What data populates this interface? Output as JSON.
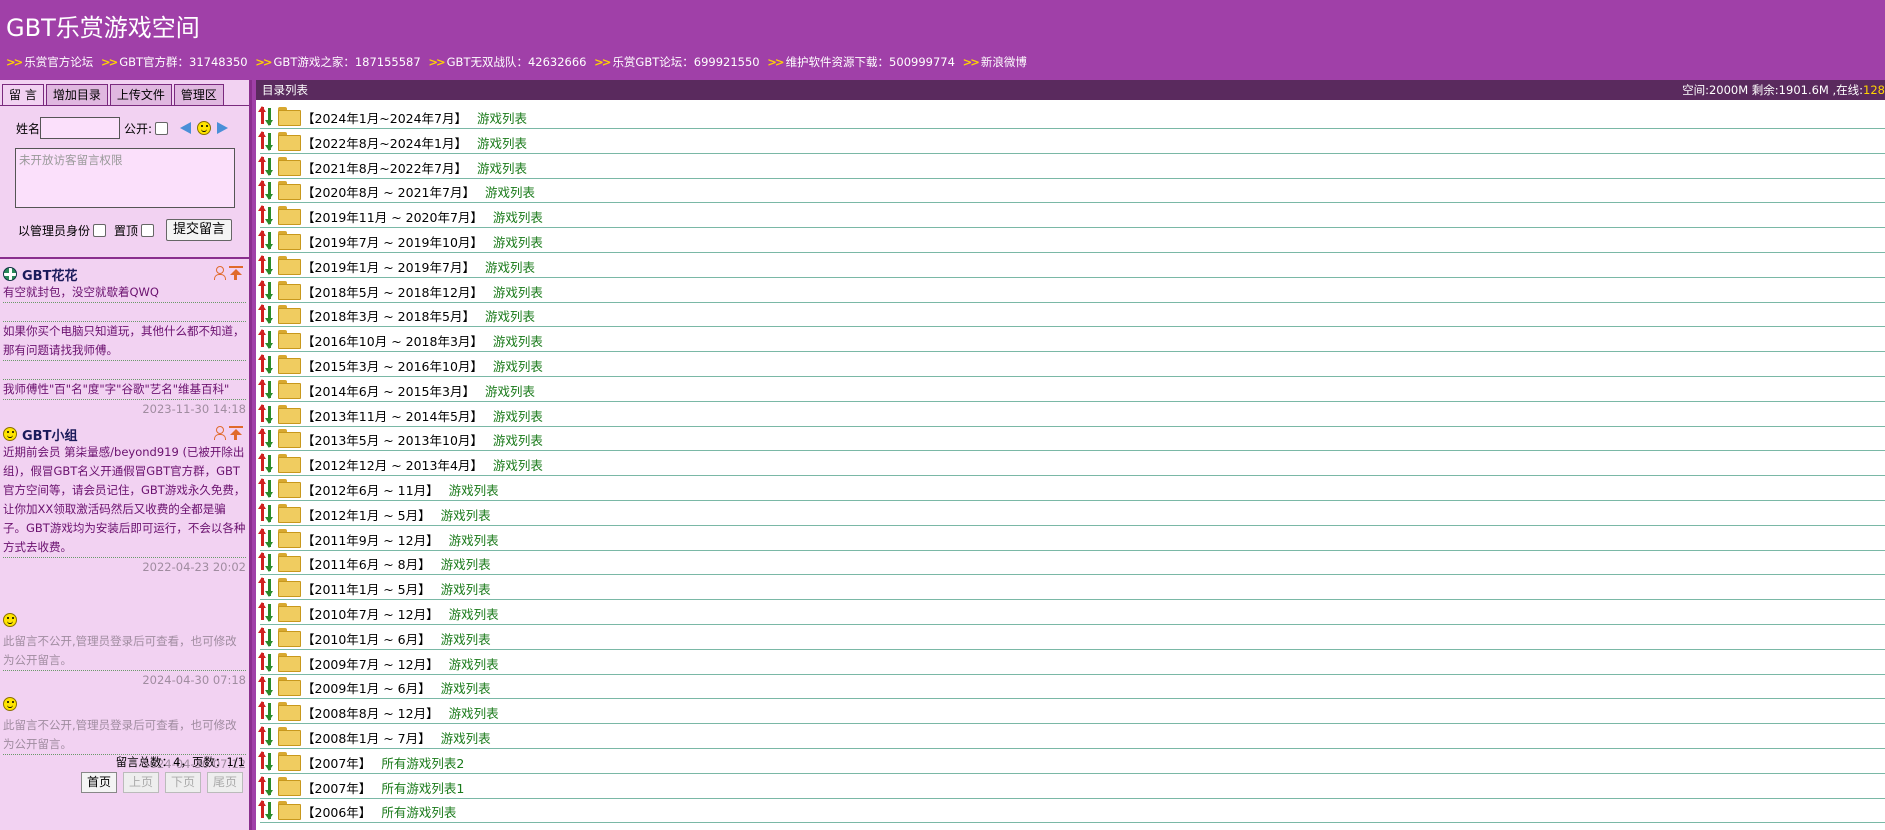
{
  "site_title": "GBT乐赏游戏空间",
  "links": [
    "乐赏官方论坛",
    "GBT官方群：31748350",
    "GBT游戏之家：187155587",
    "GBT无双战队：42632666",
    "乐赏GBT论坛：699921550",
    "维护软件资源下载：500999774",
    "新浪微博"
  ],
  "links_arrow": ">>",
  "tabs": [
    "留 言",
    "增加目录",
    "上传文件",
    "管理区"
  ],
  "form": {
    "name_label": "姓名",
    "public_label": "公开:",
    "textarea_placeholder": "未开放访客留言权限",
    "admin_label": "以管理员身份",
    "pin_label": "置顶",
    "submit_label": "提交留言"
  },
  "messages": [
    {
      "name": "GBT花花",
      "lines": [
        "有空就封包，没空就歇着QWQ",
        "",
        "如果你买个电脑只知道玩，其他什么都不知道，那有问题请找我师傅。",
        "",
        "我师傅性\"百\"名\"度\"字\"谷歌\"艺名\"维基百科\""
      ],
      "time": "2023-11-30 14:18"
    },
    {
      "name": "GBT小组",
      "lines": [
        "近期前会员 第柒量感/beyond919 (已被开除出组)，假冒GBT名义开通假冒GBT官方群，GBT官方空间等，请会员记住，GBT游戏永久免费，让你加XX领取激活码然后又收费的全都是骗子。GBT游戏均为安装后即可运行，不会以各种方式去收费。"
      ],
      "time": "2022-04-23 20:02"
    },
    {
      "name": "",
      "lines": [
        "此留言不公开,管理员登录后可查看，也可修改为公开留言。"
      ],
      "time": "2024-04-30 07:18"
    },
    {
      "name": "",
      "lines": [
        "此留言不公开,管理员登录后可查看，也可修改为公开留言。"
      ],
      "time": "2024-04-30 07:12"
    }
  ],
  "pager": {
    "info": "留言总数：4，页数：1/1",
    "first": "首页",
    "prev": "上页",
    "next": "下页",
    "last": "尾页"
  },
  "dir": {
    "title": "目录列表",
    "space_info": "空间:2000M 剩余:1901.6M ,在线:",
    "online": "128",
    "rows": [
      {
        "name": "【2024年1月~2024年7月】",
        "link": "游戏列表"
      },
      {
        "name": "【2022年8月~2024年1月】",
        "link": "游戏列表"
      },
      {
        "name": "【2021年8月~2022年7月】",
        "link": "游戏列表"
      },
      {
        "name": "【2020年8月 ~ 2021年7月】",
        "link": "游戏列表"
      },
      {
        "name": "【2019年11月 ~ 2020年7月】",
        "link": "游戏列表"
      },
      {
        "name": "【2019年7月 ~ 2019年10月】",
        "link": "游戏列表"
      },
      {
        "name": "【2019年1月 ~ 2019年7月】",
        "link": "游戏列表"
      },
      {
        "name": "【2018年5月 ~ 2018年12月】",
        "link": "游戏列表"
      },
      {
        "name": "【2018年3月 ~ 2018年5月】",
        "link": "游戏列表"
      },
      {
        "name": "【2016年10月 ~ 2018年3月】",
        "link": "游戏列表"
      },
      {
        "name": "【2015年3月 ~ 2016年10月】",
        "link": "游戏列表"
      },
      {
        "name": "【2014年6月 ~ 2015年3月】",
        "link": "游戏列表"
      },
      {
        "name": "【2013年11月 ~ 2014年5月】",
        "link": "游戏列表"
      },
      {
        "name": "【2013年5月 ~ 2013年10月】",
        "link": "游戏列表"
      },
      {
        "name": "【2012年12月 ~ 2013年4月】",
        "link": "游戏列表"
      },
      {
        "name": "【2012年6月 ~ 11月】",
        "link": "游戏列表"
      },
      {
        "name": "【2012年1月 ~ 5月】",
        "link": "游戏列表"
      },
      {
        "name": "【2011年9月 ~ 12月】",
        "link": "游戏列表"
      },
      {
        "name": "【2011年6月 ~ 8月】",
        "link": "游戏列表"
      },
      {
        "name": "【2011年1月 ~ 5月】",
        "link": "游戏列表"
      },
      {
        "name": "【2010年7月 ~ 12月】",
        "link": "游戏列表"
      },
      {
        "name": "【2010年1月 ~ 6月】",
        "link": "游戏列表"
      },
      {
        "name": "【2009年7月 ~ 12月】",
        "link": "游戏列表"
      },
      {
        "name": "【2009年1月 ~ 6月】",
        "link": "游戏列表"
      },
      {
        "name": "【2008年8月 ~ 12月】",
        "link": "游戏列表"
      },
      {
        "name": "【2008年1月 ~ 7月】",
        "link": "游戏列表"
      },
      {
        "name": "【2007年】",
        "link": "所有游戏列表2"
      },
      {
        "name": "【2007年】",
        "link": "所有游戏列表1"
      },
      {
        "name": "【2006年】",
        "link": "所有游戏列表"
      }
    ]
  },
  "colors": {
    "header_bg": "#a040a8",
    "panel_bg": "#f2d2f2",
    "dir_bar_bg": "#5a2a5e",
    "link_green": "#1a7a1a",
    "message_text": "#6a106e"
  }
}
